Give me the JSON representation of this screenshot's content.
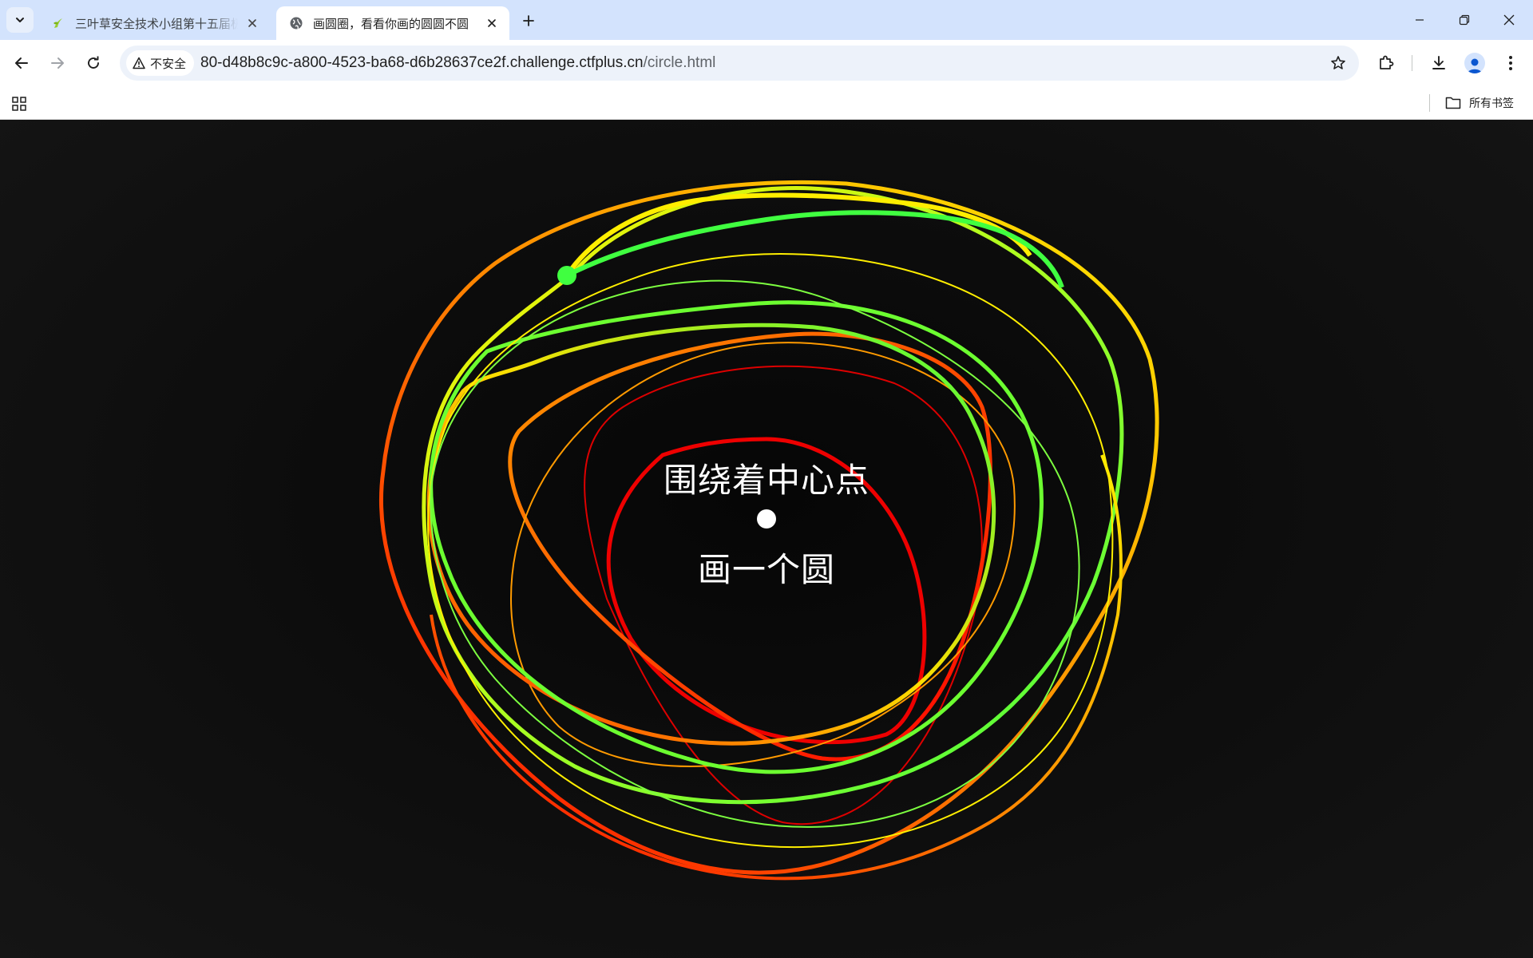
{
  "browser": {
    "tabs": [
      {
        "title": "三叶草安全技术小组第十五届极",
        "favicon": "clover-icon",
        "active": false
      },
      {
        "title": "画圆圈，看看你画的圆圆不圆",
        "favicon": "globe-icon",
        "active": true
      }
    ],
    "omnibox": {
      "security_label": "不安全",
      "url_host": "80-d48b8c9c-a800-4523-ba68-d6b28637ce2f.challenge.ctfplus.cn",
      "url_path": "/circle.html"
    },
    "bookmarks": {
      "all_bookmarks_label": "所有书签"
    }
  },
  "page": {
    "prompt_top": "围绕着中心点",
    "prompt_bottom": "画一个圆",
    "background": "#111111",
    "stroke_colors": [
      "#ff0000",
      "#ff8000",
      "#ffff00",
      "#80ff20",
      "#40ff40"
    ]
  }
}
